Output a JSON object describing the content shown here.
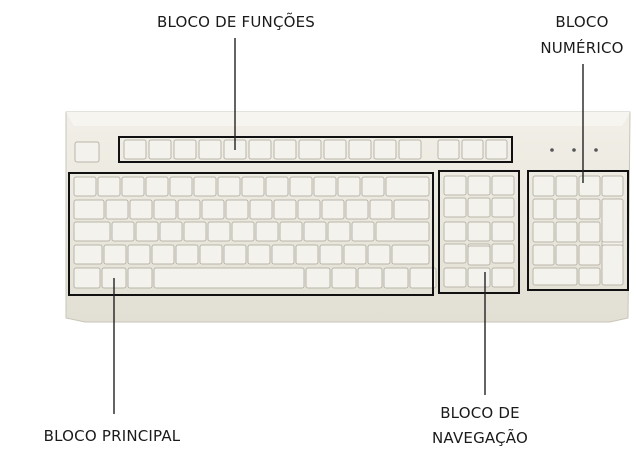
{
  "labels": {
    "function_block": "BLOCO DE FUNÇÕES",
    "numeric_block_line1": "BLOCO",
    "numeric_block_line2": "NUMÉRICO",
    "main_block": "BLOCO PRINCIPAL",
    "navigation_block_line1": "BLOCO DE",
    "navigation_block_line2": "NAVEGAÇÃO"
  },
  "colors": {
    "keyboard_body": "#ece9df",
    "key_face": "#f4f2ec",
    "key_border": "#b9b5aa",
    "outline": "#111111",
    "leader_line": "#222222",
    "led": "#555555"
  }
}
